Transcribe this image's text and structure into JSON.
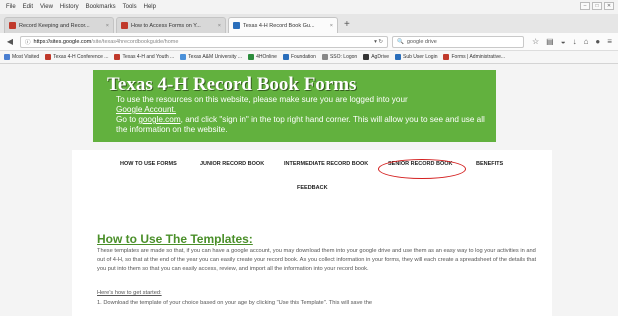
{
  "menubar": {
    "items": [
      "File",
      "Edit",
      "View",
      "History",
      "Bookmarks",
      "Tools",
      "Help"
    ]
  },
  "tabs": [
    {
      "label": "Record Keeping and Recor...",
      "fav": "red"
    },
    {
      "label": "How to Access Forms on Y...",
      "fav": "red"
    },
    {
      "label": "Texas 4-H Record Book Gu...",
      "fav": "blue"
    }
  ],
  "navbar": {
    "url_host": "https://sites.google.com",
    "url_rest": "/site/texas4hrecordbookguide/home",
    "search_value": "google drive"
  },
  "bookmarks": [
    {
      "label": "Most Visited",
      "color": "#4a7fd1"
    },
    {
      "label": "Texas 4-H Conference ...",
      "color": "#c0392b"
    },
    {
      "label": "Texas 4-H and Youth ...",
      "color": "#c0392b"
    },
    {
      "label": "Texas A&M University ...",
      "color": "#4a90d9"
    },
    {
      "label": "4HOnline",
      "color": "#2c8c3c"
    },
    {
      "label": "Foundation",
      "color": "#2a6ebb"
    },
    {
      "label": "SSO: Logon",
      "color": "#888888"
    },
    {
      "label": "AgDrive",
      "color": "#333333"
    },
    {
      "label": "Sub User Login",
      "color": "#2a6ebb"
    },
    {
      "label": "Forms | Administrative...",
      "color": "#c0392b"
    }
  ],
  "banner": {
    "title": "Texas 4-H Record Book Forms",
    "line1": "To use the resources on this website, please make sure you are logged into your",
    "link_account": "Google Account.",
    "line2_pre": "Go to ",
    "link_google": "google.com",
    "line2_post": ", and click \"sign in\" in the top right hand corner. This will allow you to see and use all the information on the website."
  },
  "nav": {
    "how_to": "HOW TO USE FORMS",
    "junior": "JUNIOR RECORD BOOK",
    "intermediate": "INTERMEDIATE RECORD BOOK",
    "senior": "SENIOR RECORD BOOK",
    "benefits": "BENEFITS",
    "feedback": "FEEDBACK"
  },
  "main": {
    "title": "How to Use The Templates:",
    "paragraph": "These templates are made so that, if you can have a google account, you may download them into your google drive and use them as an easy way to log your activities in and out of 4-H, so that at the end of the year you can easily create your record book. As you collect information in your forms, they will each create a spreadsheet of the details that you put into them so that you can easily access, review, and import all the information into your record book.",
    "subhead": "Here's how to get started:",
    "step1": "1. Download the template of your choice based on your age by clicking \"Use this Template\". This will save the"
  },
  "colors": {
    "banner_green": "#62b13e",
    "heading_green": "#4a8f29",
    "highlight_red": "#d42020"
  }
}
